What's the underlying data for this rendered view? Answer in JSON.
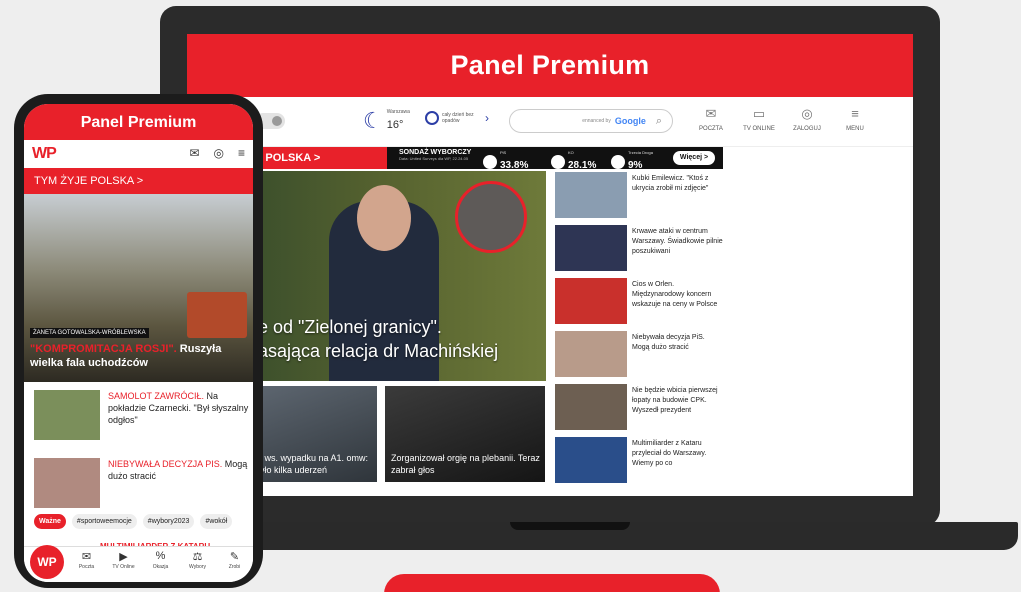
{
  "colors": {
    "accent": "#e8212a",
    "dark": "#2b2b2b"
  },
  "laptop": {
    "banner": "Panel Premium",
    "header": {
      "weather_city": "Warszawa",
      "weather_temp": "16°",
      "weather_note": "cały dzień bez opadów",
      "search_powered": "ennanced by",
      "search_engine": "Google",
      "icons": [
        {
          "icon": "mail-icon",
          "label": "POCZTA"
        },
        {
          "icon": "tv-icon",
          "label": "TV ONLINE"
        },
        {
          "icon": "user-icon",
          "label": "ZALOGUJ"
        },
        {
          "icon": "menu-icon",
          "label": "MENU"
        }
      ]
    },
    "breaking": {
      "section": "E POLSKA >",
      "poll_title": "SONDAŻ WYBORCZY",
      "poll_source": "Data: United Surveys dla WP, 22.24.05",
      "items": [
        {
          "party": "PiS",
          "value": "33.8%"
        },
        {
          "party": "KO",
          "value": "28.1%"
        },
        {
          "party": "Trzecia Droga",
          "value": "9%"
        }
      ],
      "more": "Więcej >"
    },
    "hero_caption_line1": "ze od \"Zielonej granicy\".",
    "hero_caption_line2": "zasająca relacja dr Machińskiej",
    "cards": [
      {
        "text": "ty ws. wypadku na A1. omw: było kilka uderzeń"
      },
      {
        "text": "Zorganizował orgię na plebanii. Teraz zabrał głos"
      }
    ],
    "side_list": [
      "Kubki Emilewicz. \"Ktoś z ukrycia zrobił mi zdjęcie\"",
      "Krwawe ataki w centrum Warszawy. Świadkowie pilnie poszukiwani",
      "Cios w Orlen. Międzynarodowy koncern wskazuje na ceny w Polsce",
      "Niebywała decyzja PiS. Mogą dużo stracić",
      "Nie będzie wbicia pierwszej łopaty na budowie CPK. Wyszedł prezydent",
      "Multimiliarder z Kataru przyleciał do Warszawy. Wiemy po co"
    ]
  },
  "phone": {
    "banner": "Panel Premium",
    "logo": "WP",
    "section": "TYM ŻYJE POLSKA >",
    "author": "ŻANETA GOTOWALSKA-WRÓBLEWSKA",
    "hero_highlight": "\"KOMPROMITACJA ROSJI\".",
    "hero_title_rest": " Ruszyła wielka fala uchodźców",
    "items": [
      {
        "highlight": "SAMOLOT ZAWRÓCIŁ.",
        "rest": " Na pokładzie Czarnecki. \"Był słyszalny odgłos\""
      },
      {
        "highlight": "NIEBYWAŁA DECYZJA PIS.",
        "rest": " Mogą dużo stracić"
      }
    ],
    "tags": [
      "Ważne",
      "#sportoweemocje",
      "#wybory2023",
      "#wokół"
    ],
    "peek": "MULTIMILIARDER Z KATARU",
    "nav": [
      {
        "icon": "mail-icon",
        "label": "Poczta"
      },
      {
        "icon": "tv-icon",
        "label": "TV Online"
      },
      {
        "icon": "percent-icon",
        "label": "Okazja"
      },
      {
        "icon": "vote-icon",
        "label": "Wybory"
      },
      {
        "icon": "pen-icon",
        "label": "Zrobi"
      }
    ]
  }
}
